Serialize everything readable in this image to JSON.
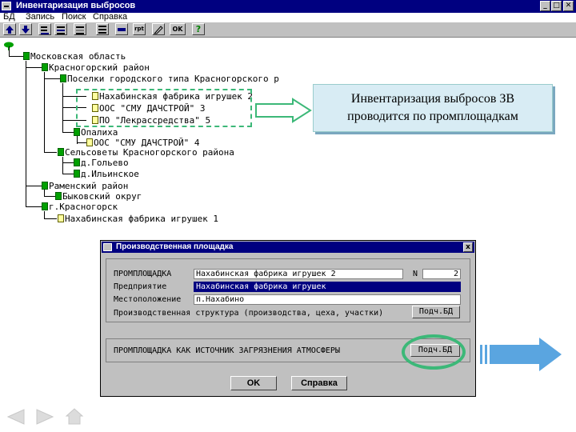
{
  "window": {
    "title": "Инвентаризация выбросов",
    "buttons": {
      "minimize": "_",
      "maximize": "□",
      "close": "✕"
    }
  },
  "menu": [
    "БД",
    "Запись",
    "Поиск",
    "Справка"
  ],
  "toolbar": {
    "report_label": "rpt",
    "ok_label": "OK",
    "help_label": "?"
  },
  "tree": {
    "region": "Московская область",
    "district1": "Красногорский район",
    "settlement": "Поселки городского типа Красногорского р",
    "site1": "Нахабинская фабрика игрушек 2",
    "site2": "ООС \"СМУ ДАЧСТРОЙ\" 3",
    "site3": "ПО \"Лекрассредства\" 5",
    "town": "Опалиха",
    "site4": "ООС \"СМУ ДАЧСТРОЙ\" 4",
    "councils": "Сельсоветы Красногорского района",
    "village1": "д.Гольево",
    "village2": "д.Ильинское",
    "district2": "Раменский район",
    "okrug": "Быковский округ",
    "city": "г.Красногорск",
    "site5": "Нахабинская фабрика игрушек 1"
  },
  "callout": {
    "line1": "Инвентаризация выбросов ЗВ",
    "line2": "проводится по промплощадкам"
  },
  "dialog": {
    "title": "Производственная площадка",
    "site_label": "ПРОМПЛОЩАДКА",
    "site_value": "Нахабинская фабрика игрушек 2",
    "number_label": "N",
    "number_value": "2",
    "enterprise_label": "Предприятие",
    "enterprise_value": "Нахабинская фабрика игрушек",
    "location_label": "Местоположение",
    "location_value": "п.Нахабино",
    "structure_label": "Производственная структура (производства, цеха, участки)",
    "structure_button": "Подч.БД",
    "pollution_label": "ПРОМПЛОЩАДКА КАК ИСТОЧНИК ЗАГРЯЗНЕНИЯ АТМОСФЕРЫ",
    "pollution_button": "Подч.БД",
    "ok_button": "OK",
    "help_button": "Справка"
  },
  "colors": {
    "title": "#000080",
    "callout": "#d8ecf4",
    "highlight": "#3cb878",
    "arrow": "#5aa5e0"
  }
}
